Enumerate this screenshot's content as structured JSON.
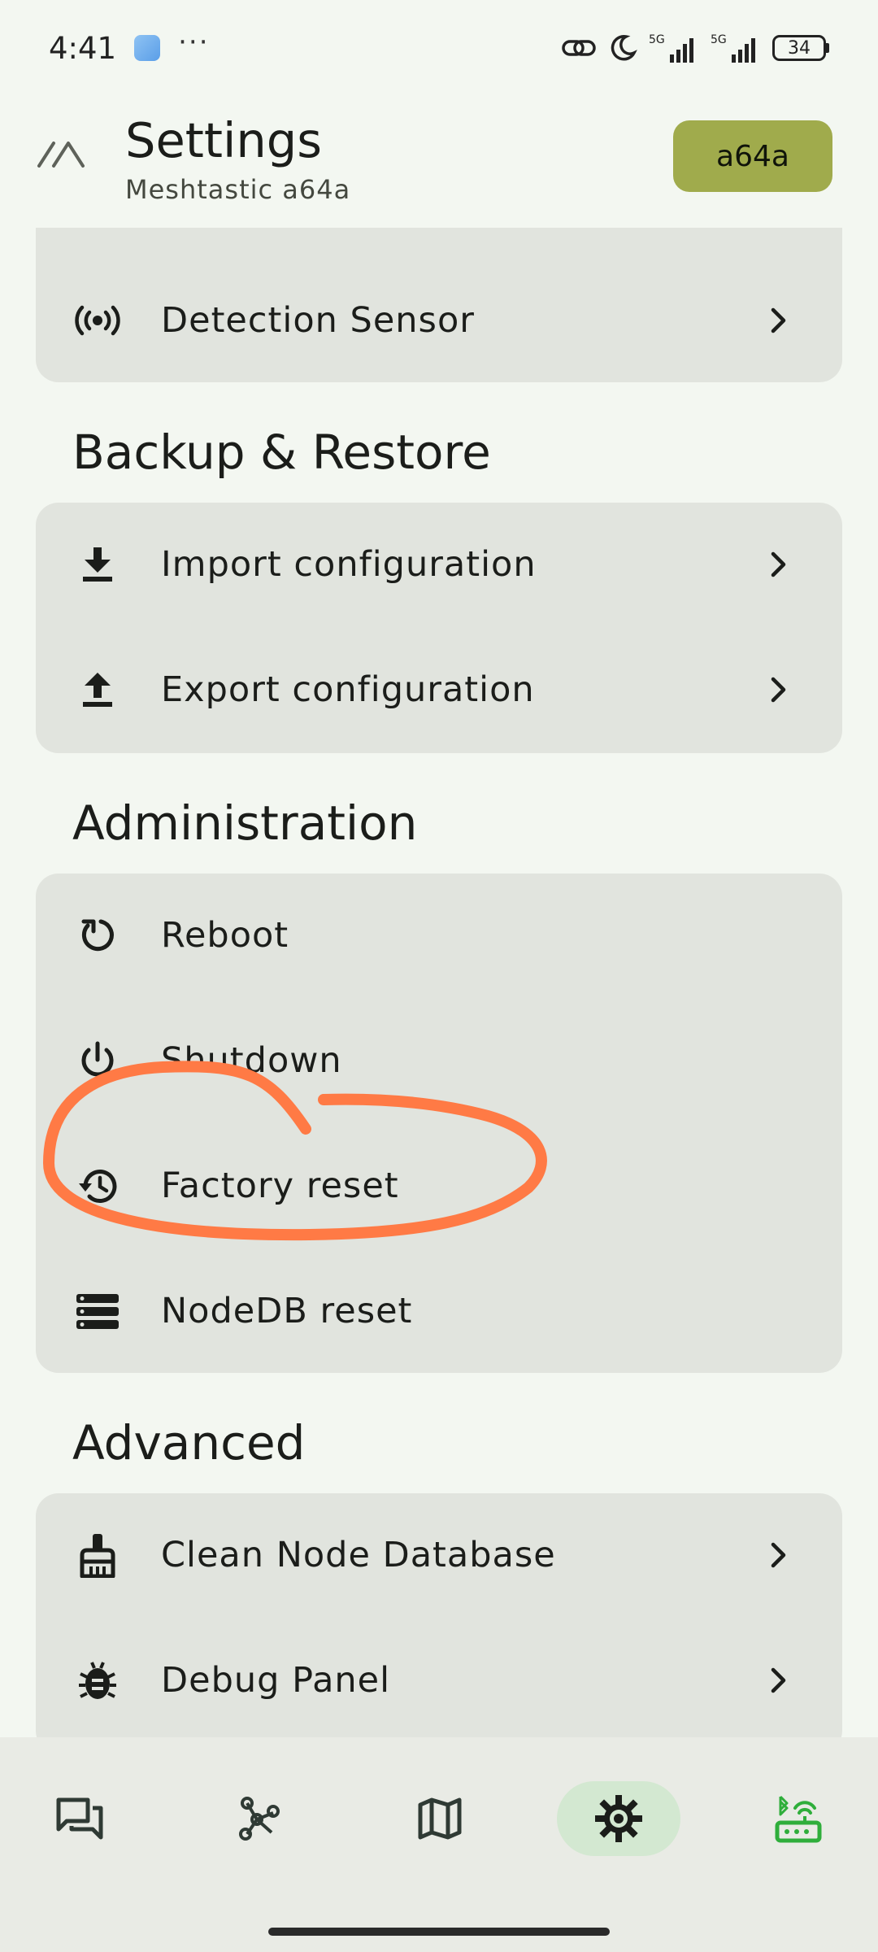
{
  "status_bar": {
    "time": "4:41",
    "dots": "···",
    "network_1": "5G",
    "network_2": "5G",
    "battery": "34",
    "icons": [
      "app-notification-icon",
      "link-icon",
      "moon-icon",
      "signal-icon",
      "battery-icon"
    ]
  },
  "header": {
    "title": "Settings",
    "subtitle": "Meshtastic a64a",
    "node_chip": "a64a",
    "accent_color": "#a0ab4c"
  },
  "cards": {
    "top": {
      "items": [
        {
          "label": "Detection Sensor",
          "icon": "sensors-icon",
          "chevron": true
        }
      ]
    },
    "backup": {
      "section_title": "Backup & Restore",
      "items": [
        {
          "label": "Import configuration",
          "icon": "download-icon",
          "chevron": true
        },
        {
          "label": "Export configuration",
          "icon": "upload-icon",
          "chevron": true
        }
      ]
    },
    "administration": {
      "section_title": "Administration",
      "items": [
        {
          "label": "Reboot",
          "icon": "restart-icon"
        },
        {
          "label": "Shutdown",
          "icon": "power-icon"
        },
        {
          "label": "Factory reset",
          "icon": "history-icon"
        },
        {
          "label": "NodeDB reset",
          "icon": "storage-icon"
        }
      ]
    },
    "advanced": {
      "section_title": "Advanced",
      "items": [
        {
          "label": "Clean Node Database",
          "icon": "broom-icon",
          "chevron": true
        },
        {
          "label": "Debug Panel",
          "icon": "bug-icon",
          "chevron": true
        }
      ]
    }
  },
  "annotation": {
    "target": "Factory reset",
    "color": "#ff7a45"
  },
  "bottom_nav": {
    "items": [
      {
        "name": "messages",
        "icon": "chat-icon",
        "active": false
      },
      {
        "name": "nodes",
        "icon": "graph-icon",
        "active": false
      },
      {
        "name": "map",
        "icon": "map-icon",
        "active": false
      },
      {
        "name": "settings",
        "icon": "gear-icon",
        "active": true
      },
      {
        "name": "connections",
        "icon": "bluetooth-router-icon",
        "active": false
      }
    ],
    "active_color": "#d3e8d1",
    "connection_color": "#2fae3b"
  }
}
